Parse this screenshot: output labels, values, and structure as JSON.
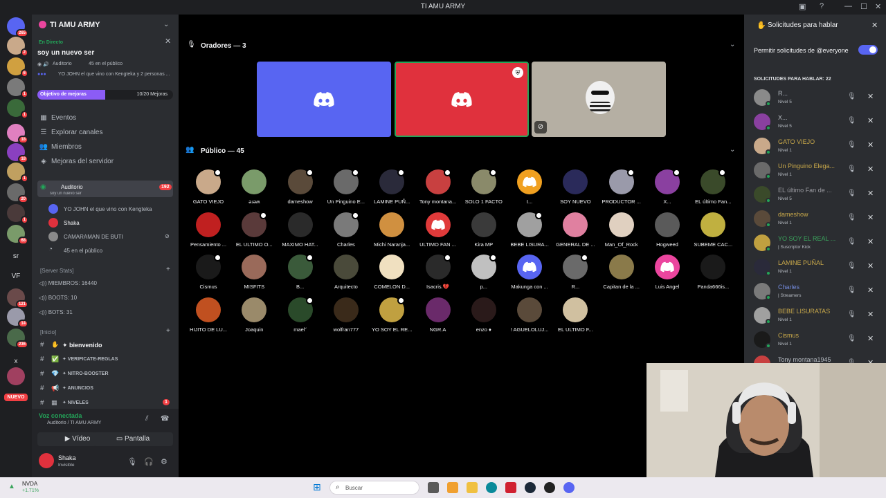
{
  "window": {
    "title": "TI AMU ARMY"
  },
  "rail": {
    "badges": [
      "265",
      "2",
      "6",
      "1",
      "1",
      "18",
      "18",
      "1",
      "20",
      "1",
      "68",
      "121",
      "14",
      "236"
    ],
    "text_servers": [
      "sr",
      "VF",
      "x"
    ],
    "nuevo_label": "NUEVO"
  },
  "sidebar": {
    "guild_name": "TI AMU ARMY",
    "live_label": "En Directo",
    "live_title": "soy un nuevo ser",
    "live_channel": "Auditorio",
    "live_audience": "45 en el público",
    "live_speakers": "YO JOHN el que vino con Kengteka y 2 personas ...",
    "goal_label": "Objetivo de mejoras",
    "goal_progress": "10/20 Mejoras",
    "goal_fraction": 0.5,
    "nav": [
      "Eventos",
      "Explorar canales",
      "Miembros",
      "Mejoras del servidor"
    ],
    "stage_channel": {
      "name": "Auditorio",
      "subtitle": "soy un nuevo ser",
      "badge": "192"
    },
    "voice_users": [
      "YO JOHN el que vino con Kengteka",
      "Shaka",
      "CAMARAMAN DE BUTI",
      "45 en el público"
    ],
    "stats_category": "[Server Stats]",
    "stats": [
      "MIEMBROS: 16440",
      "BOOTS: 10",
      "BOTS: 31"
    ],
    "inicio_category": "[Inicio]",
    "channels": [
      {
        "name": "bienvenido",
        "badge": ""
      },
      {
        "name": "verificate-reglas",
        "badge": ""
      },
      {
        "name": "nitro-booster",
        "badge": ""
      },
      {
        "name": "anuncios",
        "badge": ""
      },
      {
        "name": "niveles",
        "badge": "1"
      }
    ],
    "voice_connected": "Voz conectada",
    "voice_location": "Auditorio / TI AMU ARMY",
    "video_button": "Vídeo",
    "screen_button": "Pantalla",
    "user_name": "Shaka",
    "user_status": "Invisible"
  },
  "stage": {
    "speakers_title": "Oradores — 3",
    "audience_title": "Público — 45",
    "speakers": [
      {
        "color": "#5865f2"
      },
      {
        "color": "#e0313d"
      },
      {
        "color": "#b5afa3"
      }
    ],
    "audience": [
      {
        "name": "GATO VIEJO",
        "color": "#c9a98a"
      },
      {
        "name": "ǝɹǝʍ",
        "color": "#7a9b6a"
      },
      {
        "name": "dameshow",
        "color": "#5a4a3a"
      },
      {
        "name": "Un Pinguino E...",
        "color": "#6a6a6a"
      },
      {
        "name": "LAMINE PUÑ...",
        "color": "#2a2a3a"
      },
      {
        "name": "Tony montana...",
        "color": "#c84040"
      },
      {
        "name": "SOLO 1 FACTO",
        "color": "#8a8a6a"
      },
      {
        "name": "t...",
        "color": "#f0a020"
      },
      {
        "name": "SOY NUEVO",
        "color": "#2a2a5a"
      },
      {
        "name": "PRODUCTOR ...",
        "color": "#9a9aaa"
      },
      {
        "name": "X...",
        "color": "#8a40a0"
      },
      {
        "name": "EL último Fan...",
        "color": "#3a4a2a"
      },
      {
        "name": "Pensamiento ...",
        "color": "#c02020"
      },
      {
        "name": "EL ULTIMO O...",
        "color": "#5a3a3a"
      },
      {
        "name": "MAXIMO HAT...",
        "color": "#2a2a2a"
      },
      {
        "name": "Charles",
        "color": "#7a7a7a"
      },
      {
        "name": "Michi Naranja...",
        "color": "#d09040"
      },
      {
        "name": "ULTIMO FAN ...",
        "color": "#e03a3a"
      },
      {
        "name": "Kira MP",
        "color": "#3a3a3a"
      },
      {
        "name": "BEBE LISURA...",
        "color": "#a0a0a0"
      },
      {
        "name": "GENERAL DE ...",
        "color": "#e080a0"
      },
      {
        "name": "Man_Of_Rock",
        "color": "#e0d0c0"
      },
      {
        "name": "Hogweed",
        "color": "#5a5a5a"
      },
      {
        "name": "SUBEME CAC...",
        "color": "#c0b040"
      },
      {
        "name": "Cismus",
        "color": "#1a1a1a"
      },
      {
        "name": "MISFITS",
        "color": "#9a6a5a"
      },
      {
        "name": "B...",
        "color": "#3a5a3a"
      },
      {
        "name": "Arquitecto",
        "color": "#4a4a3a"
      },
      {
        "name": "COMELON D...",
        "color": "#f0e0c0"
      },
      {
        "name": "Isacris.💔",
        "color": "#2a2a2a"
      },
      {
        "name": "p...",
        "color": "#c0c0c0"
      },
      {
        "name": "Makunga con ...",
        "color": "#5865f2"
      },
      {
        "name": "R...",
        "color": "#6a6a6a"
      },
      {
        "name": "Capitan de la ...",
        "color": "#8a7a4a"
      },
      {
        "name": "Luis Angel",
        "color": "#eb459e"
      },
      {
        "name": "Panda666is...",
        "color": "#1a1a1a"
      },
      {
        "name": "HIJITO DE LU...",
        "color": "#c05020"
      },
      {
        "name": "Joaquin",
        "color": "#9a8a6a"
      },
      {
        "name": "mael˘",
        "color": "#2a4a2a"
      },
      {
        "name": "wolfran777",
        "color": "#3a2a1a"
      },
      {
        "name": "YO SOY EL RE...",
        "color": "#c0a040"
      },
      {
        "name": "NGR.A",
        "color": "#6a2a6a"
      },
      {
        "name": "enzo ♦",
        "color": "#2a1a1a"
      },
      {
        "name": "! AGUELOLUJ...",
        "color": "#5a4a3a"
      },
      {
        "name": "EL ULTIMO F...",
        "color": "#d0c0a0"
      }
    ]
  },
  "requests": {
    "title": "Solicitudes para hablar",
    "permit_label": "Permitir solicitudes de @everyone",
    "count_label": "SOLICITUDES PARA HABLAR: 22",
    "items": [
      {
        "name": "R...",
        "level": "Nivel 5",
        "color": "#b5bac1",
        "av": "#8a8a8a"
      },
      {
        "name": "X...",
        "level": "Nivel 5",
        "color": "#b5bac1",
        "av": "#8a40a0"
      },
      {
        "name": "GATO VIEJO",
        "level": "Nivel 1",
        "color": "#c8a84a",
        "av": "#c9a98a"
      },
      {
        "name": "Un Pinguino Elega...",
        "level": "Nivel 1",
        "color": "#c8a84a",
        "av": "#6a6a6a"
      },
      {
        "name": "EL último Fan de ...",
        "level": "Nivel 5",
        "color": "#9a9aa0",
        "av": "#3a4a2a"
      },
      {
        "name": "dameshow",
        "level": "Nivel 1",
        "color": "#c8a84a",
        "av": "#5a4a3a"
      },
      {
        "name": "YO SOY EL REAL ...",
        "level": "| Suscriptor Kick",
        "color": "#3ba55d",
        "av": "#c0a040"
      },
      {
        "name": "LAMINE PUÑAL",
        "level": "Nivel 1",
        "color": "#c8a84a",
        "av": "#2a2a3a"
      },
      {
        "name": "Charles",
        "level": "| Streamers",
        "color": "#7289da",
        "av": "#7a7a7a"
      },
      {
        "name": "BEBE LISURATAS",
        "level": "Nivel 1",
        "color": "#c8a84a",
        "av": "#a0a0a0"
      },
      {
        "name": "Cismus",
        "level": "Nivel 1",
        "color": "#c8a84a",
        "av": "#1a1a1a"
      },
      {
        "name": "Tony montana1945",
        "level": "",
        "color": "#b5bac1",
        "av": "#c84040"
      }
    ]
  },
  "taskbar": {
    "stock_name": "NVDA",
    "stock_change": "+1.71%",
    "search_placeholder": "Buscar"
  }
}
